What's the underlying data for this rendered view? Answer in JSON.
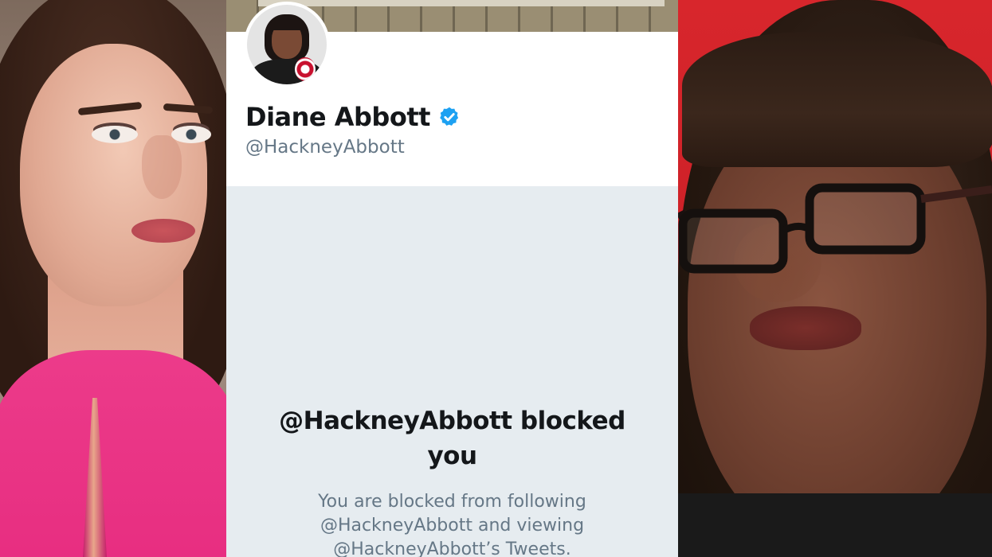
{
  "profile": {
    "display_name": "Diane Abbott",
    "handle": "@HackneyAbbott",
    "verified": true
  },
  "blocked_notice": {
    "heading": "@HackneyAbbott blocked you",
    "message": "You are blocked from following @HackneyAbbott and viewing @HackneyAbbott’s Tweets."
  },
  "colors": {
    "verified_badge": "#1da1f2",
    "name_text": "#14171a",
    "secondary_text": "#657786",
    "blocked_background": "#e6ecf0",
    "left_dress": "#e72d80",
    "right_background": "#c91f26"
  },
  "icons": {
    "verified": "verified-badge-icon"
  }
}
